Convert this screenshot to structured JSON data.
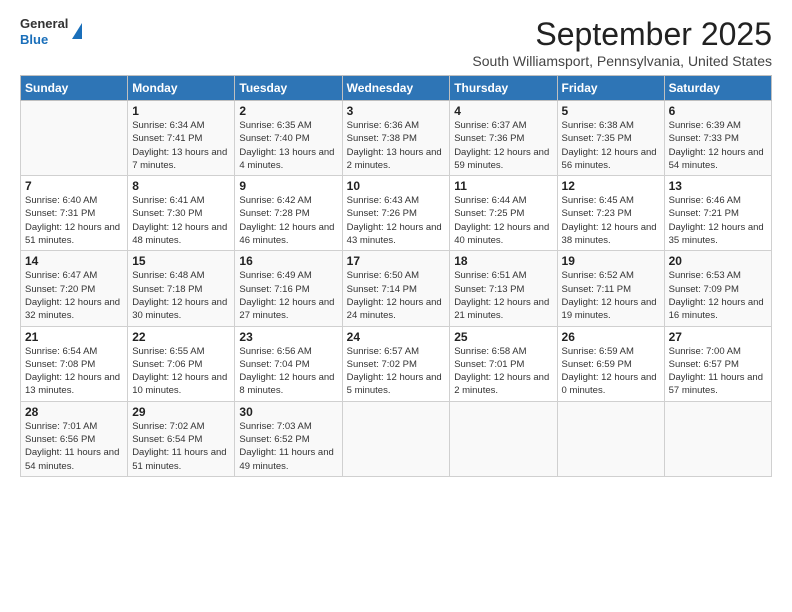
{
  "header": {
    "logo_general": "General",
    "logo_blue": "Blue",
    "month_title": "September 2025",
    "location": "South Williamsport, Pennsylvania, United States"
  },
  "days_of_week": [
    "Sunday",
    "Monday",
    "Tuesday",
    "Wednesday",
    "Thursday",
    "Friday",
    "Saturday"
  ],
  "weeks": [
    [
      {
        "num": "",
        "sunrise": "",
        "sunset": "",
        "daylight": ""
      },
      {
        "num": "1",
        "sunrise": "Sunrise: 6:34 AM",
        "sunset": "Sunset: 7:41 PM",
        "daylight": "Daylight: 13 hours and 7 minutes."
      },
      {
        "num": "2",
        "sunrise": "Sunrise: 6:35 AM",
        "sunset": "Sunset: 7:40 PM",
        "daylight": "Daylight: 13 hours and 4 minutes."
      },
      {
        "num": "3",
        "sunrise": "Sunrise: 6:36 AM",
        "sunset": "Sunset: 7:38 PM",
        "daylight": "Daylight: 13 hours and 2 minutes."
      },
      {
        "num": "4",
        "sunrise": "Sunrise: 6:37 AM",
        "sunset": "Sunset: 7:36 PM",
        "daylight": "Daylight: 12 hours and 59 minutes."
      },
      {
        "num": "5",
        "sunrise": "Sunrise: 6:38 AM",
        "sunset": "Sunset: 7:35 PM",
        "daylight": "Daylight: 12 hours and 56 minutes."
      },
      {
        "num": "6",
        "sunrise": "Sunrise: 6:39 AM",
        "sunset": "Sunset: 7:33 PM",
        "daylight": "Daylight: 12 hours and 54 minutes."
      }
    ],
    [
      {
        "num": "7",
        "sunrise": "Sunrise: 6:40 AM",
        "sunset": "Sunset: 7:31 PM",
        "daylight": "Daylight: 12 hours and 51 minutes."
      },
      {
        "num": "8",
        "sunrise": "Sunrise: 6:41 AM",
        "sunset": "Sunset: 7:30 PM",
        "daylight": "Daylight: 12 hours and 48 minutes."
      },
      {
        "num": "9",
        "sunrise": "Sunrise: 6:42 AM",
        "sunset": "Sunset: 7:28 PM",
        "daylight": "Daylight: 12 hours and 46 minutes."
      },
      {
        "num": "10",
        "sunrise": "Sunrise: 6:43 AM",
        "sunset": "Sunset: 7:26 PM",
        "daylight": "Daylight: 12 hours and 43 minutes."
      },
      {
        "num": "11",
        "sunrise": "Sunrise: 6:44 AM",
        "sunset": "Sunset: 7:25 PM",
        "daylight": "Daylight: 12 hours and 40 minutes."
      },
      {
        "num": "12",
        "sunrise": "Sunrise: 6:45 AM",
        "sunset": "Sunset: 7:23 PM",
        "daylight": "Daylight: 12 hours and 38 minutes."
      },
      {
        "num": "13",
        "sunrise": "Sunrise: 6:46 AM",
        "sunset": "Sunset: 7:21 PM",
        "daylight": "Daylight: 12 hours and 35 minutes."
      }
    ],
    [
      {
        "num": "14",
        "sunrise": "Sunrise: 6:47 AM",
        "sunset": "Sunset: 7:20 PM",
        "daylight": "Daylight: 12 hours and 32 minutes."
      },
      {
        "num": "15",
        "sunrise": "Sunrise: 6:48 AM",
        "sunset": "Sunset: 7:18 PM",
        "daylight": "Daylight: 12 hours and 30 minutes."
      },
      {
        "num": "16",
        "sunrise": "Sunrise: 6:49 AM",
        "sunset": "Sunset: 7:16 PM",
        "daylight": "Daylight: 12 hours and 27 minutes."
      },
      {
        "num": "17",
        "sunrise": "Sunrise: 6:50 AM",
        "sunset": "Sunset: 7:14 PM",
        "daylight": "Daylight: 12 hours and 24 minutes."
      },
      {
        "num": "18",
        "sunrise": "Sunrise: 6:51 AM",
        "sunset": "Sunset: 7:13 PM",
        "daylight": "Daylight: 12 hours and 21 minutes."
      },
      {
        "num": "19",
        "sunrise": "Sunrise: 6:52 AM",
        "sunset": "Sunset: 7:11 PM",
        "daylight": "Daylight: 12 hours and 19 minutes."
      },
      {
        "num": "20",
        "sunrise": "Sunrise: 6:53 AM",
        "sunset": "Sunset: 7:09 PM",
        "daylight": "Daylight: 12 hours and 16 minutes."
      }
    ],
    [
      {
        "num": "21",
        "sunrise": "Sunrise: 6:54 AM",
        "sunset": "Sunset: 7:08 PM",
        "daylight": "Daylight: 12 hours and 13 minutes."
      },
      {
        "num": "22",
        "sunrise": "Sunrise: 6:55 AM",
        "sunset": "Sunset: 7:06 PM",
        "daylight": "Daylight: 12 hours and 10 minutes."
      },
      {
        "num": "23",
        "sunrise": "Sunrise: 6:56 AM",
        "sunset": "Sunset: 7:04 PM",
        "daylight": "Daylight: 12 hours and 8 minutes."
      },
      {
        "num": "24",
        "sunrise": "Sunrise: 6:57 AM",
        "sunset": "Sunset: 7:02 PM",
        "daylight": "Daylight: 12 hours and 5 minutes."
      },
      {
        "num": "25",
        "sunrise": "Sunrise: 6:58 AM",
        "sunset": "Sunset: 7:01 PM",
        "daylight": "Daylight: 12 hours and 2 minutes."
      },
      {
        "num": "26",
        "sunrise": "Sunrise: 6:59 AM",
        "sunset": "Sunset: 6:59 PM",
        "daylight": "Daylight: 12 hours and 0 minutes."
      },
      {
        "num": "27",
        "sunrise": "Sunrise: 7:00 AM",
        "sunset": "Sunset: 6:57 PM",
        "daylight": "Daylight: 11 hours and 57 minutes."
      }
    ],
    [
      {
        "num": "28",
        "sunrise": "Sunrise: 7:01 AM",
        "sunset": "Sunset: 6:56 PM",
        "daylight": "Daylight: 11 hours and 54 minutes."
      },
      {
        "num": "29",
        "sunrise": "Sunrise: 7:02 AM",
        "sunset": "Sunset: 6:54 PM",
        "daylight": "Daylight: 11 hours and 51 minutes."
      },
      {
        "num": "30",
        "sunrise": "Sunrise: 7:03 AM",
        "sunset": "Sunset: 6:52 PM",
        "daylight": "Daylight: 11 hours and 49 minutes."
      },
      {
        "num": "",
        "sunrise": "",
        "sunset": "",
        "daylight": ""
      },
      {
        "num": "",
        "sunrise": "",
        "sunset": "",
        "daylight": ""
      },
      {
        "num": "",
        "sunrise": "",
        "sunset": "",
        "daylight": ""
      },
      {
        "num": "",
        "sunrise": "",
        "sunset": "",
        "daylight": ""
      }
    ]
  ]
}
